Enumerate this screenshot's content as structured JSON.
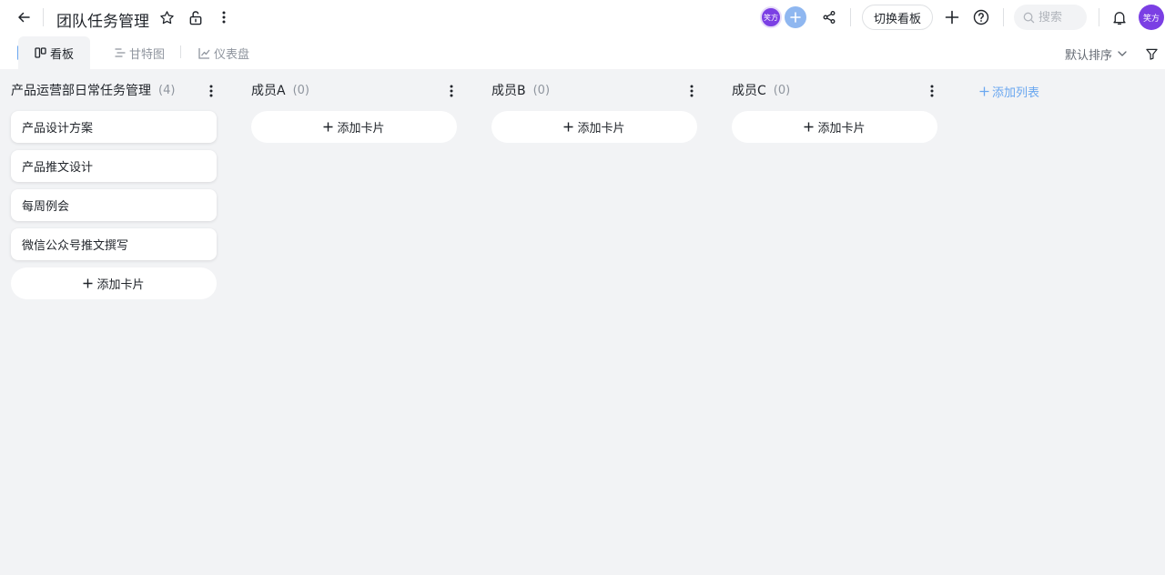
{
  "header": {
    "title": "团队任务管理",
    "avatar_label": "笑方",
    "switch_board_label": "切换看板",
    "search_placeholder": "搜索",
    "user_avatar_label": "笑方"
  },
  "tabs": [
    {
      "label": "看板",
      "icon": "board-icon",
      "active": true
    },
    {
      "label": "甘特图",
      "icon": "gantt-icon",
      "active": false
    },
    {
      "label": "仪表盘",
      "icon": "dashboard-icon",
      "active": false
    }
  ],
  "toolbar": {
    "sort_label": "默认排序"
  },
  "columns": [
    {
      "title": "产品运营部日常任务管理",
      "count": "(4)",
      "cards": [
        "产品设计方案",
        "产品推文设计",
        "每周例会",
        "微信公众号推文撰写"
      ],
      "add_card_label": "添加卡片"
    },
    {
      "title": "成员A",
      "count": "(0)",
      "cards": [],
      "add_card_label": "添加卡片"
    },
    {
      "title": "成员B",
      "count": "(0)",
      "cards": [],
      "add_card_label": "添加卡片"
    },
    {
      "title": "成员C",
      "count": "(0)",
      "cards": [],
      "add_card_label": "添加卡片"
    }
  ],
  "add_list_label": "添加列表",
  "colors": {
    "accent": "#6aa7f0",
    "avatar": "#7b3fe4",
    "background": "#f2f3f5"
  }
}
